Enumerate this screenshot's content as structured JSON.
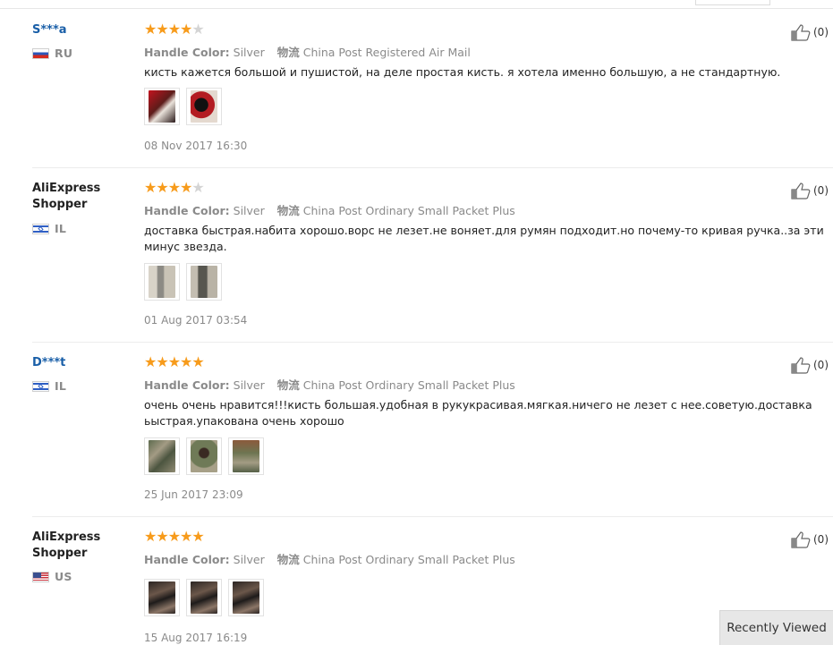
{
  "reviews": [
    {
      "user": "S***a",
      "country": "RU",
      "flag": "ru",
      "rating": 4,
      "attr_label": "Handle Color:",
      "attr_value": "Silver",
      "ship_label": "物流",
      "ship_value": "China Post Registered Air Mail",
      "text": "кисть кажется большой и пушистой, на деле простая кисть. я хотела именно большую, а не стандартную.",
      "images": [
        "t-red",
        "t-dark"
      ],
      "date": "08 Nov 2017 16:30",
      "likes": "(0)"
    },
    {
      "user": "AliExpress Shopper",
      "country": "IL",
      "flag": "il",
      "rating": 4,
      "attr_label": "Handle Color:",
      "attr_value": "Silver",
      "ship_label": "物流",
      "ship_value": "China Post Ordinary Small Packet Plus",
      "text": "доставка быстрая.набита хорошо.ворс не лезет.не воняет.для румян подходит.но почему-то кривая ручка..за эти минус звезда.",
      "images": [
        "t-grey1",
        "t-grey2"
      ],
      "date": "01 Aug 2017 03:54",
      "likes": "(0)"
    },
    {
      "user": "D***t",
      "country": "IL",
      "flag": "il",
      "rating": 5,
      "attr_label": "Handle Color:",
      "attr_value": "Silver",
      "ship_label": "物流",
      "ship_value": "China Post Ordinary Small Packet Plus",
      "text": "очень очень нравится!!!кисть большая.удобная в рукукрасивая.мягкая.ничего не лезет с нее.советую.доставка ьыстрая.упакована очень хорошо",
      "images": [
        "t-camo",
        "t-camo2",
        "t-camo3"
      ],
      "date": "25 Jun 2017 23:09",
      "likes": "(0)"
    },
    {
      "user": "AliExpress Shopper",
      "country": "US",
      "flag": "us",
      "rating": 5,
      "attr_label": "Handle Color:",
      "attr_value": "Silver",
      "ship_label": "物流",
      "ship_value": "China Post Ordinary Small Packet Plus",
      "text": "",
      "images": [
        "t-fig",
        "t-fig",
        "t-fig"
      ],
      "date": "15 Aug 2017 16:19",
      "likes": "(0)"
    }
  ],
  "recently_viewed": "Recently Viewed",
  "colors": {
    "star": "#f79b1b",
    "star_empty": "#d4d4d4",
    "masked_user": "#1a5fa8"
  },
  "icons": {
    "like": "thumbs-up-icon",
    "star": "star-icon"
  }
}
